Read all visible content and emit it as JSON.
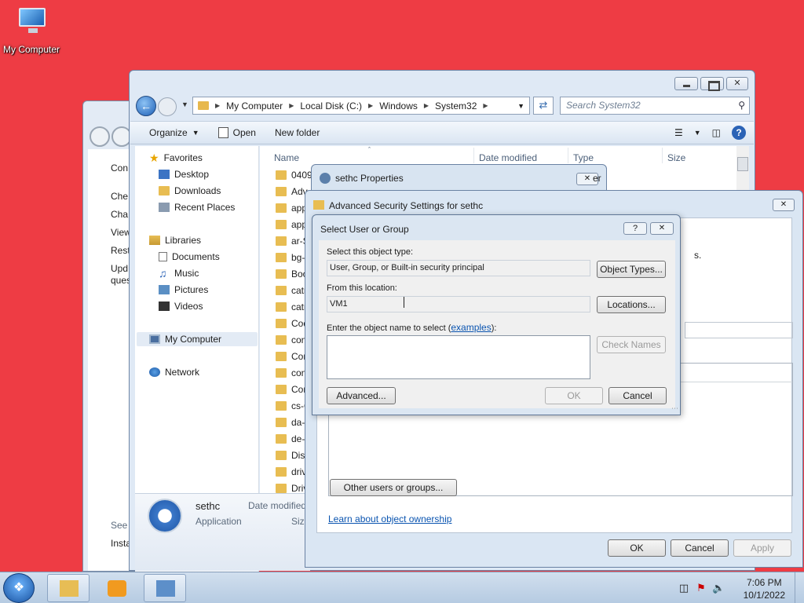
{
  "desktop": {
    "my_computer_label": "My Computer"
  },
  "back_window": {
    "links": [
      "Con",
      "Che",
      "Cha",
      "View",
      "Rest",
      "Upd",
      "ques",
      "See",
      "Installed Updates"
    ]
  },
  "explorer": {
    "breadcrumb": [
      "My Computer",
      "Local Disk (C:)",
      "Windows",
      "System32"
    ],
    "search_placeholder": "Search System32",
    "commands": {
      "organize": "Organize",
      "open": "Open",
      "new_folder": "New folder"
    },
    "nav": {
      "favorites": "Favorites",
      "desktop": "Desktop",
      "downloads": "Downloads",
      "recent": "Recent Places",
      "libraries": "Libraries",
      "documents": "Documents",
      "music": "Music",
      "pictures": "Pictures",
      "videos": "Videos",
      "my_computer": "My Computer",
      "network": "Network"
    },
    "columns": {
      "name": "Name",
      "date": "Date modified",
      "type": "Type",
      "size": "Size"
    },
    "files": [
      "0409",
      "Adv",
      "app",
      "app",
      "ar-S",
      "bg-",
      "Boo",
      "catr",
      "catr",
      "Cod",
      "con",
      "Con",
      "con",
      "Con",
      "cs-C",
      "da-",
      "de-",
      "Disn",
      "driv",
      "Driv"
    ],
    "details": {
      "name": "sethc",
      "type": "Application",
      "modified_label": "Date modified",
      "size_label": "Size"
    }
  },
  "props_window": {
    "title": "sethc Properties",
    "partial_text": "er"
  },
  "adv_window": {
    "title": "Advanced Security Settings for sethc",
    "partial_text": "s.",
    "other_users_button": "Other users or groups...",
    "learn_link": "Learn about object ownership",
    "ok": "OK",
    "cancel": "Cancel",
    "apply": "Apply"
  },
  "select_dialog": {
    "title": "Select User or Group",
    "help": "?",
    "object_type_label": "Select this object type:",
    "object_type_value": "User, Group, or Built-in security principal",
    "object_types_button": "Object Types...",
    "location_label": "From this location:",
    "location_value": "VM1",
    "locations_button": "Locations...",
    "enter_label_pre": "Enter the object name to select (",
    "examples_link": "examples",
    "enter_label_post": "):",
    "check_names_button": "Check Names",
    "advanced_button": "Advanced...",
    "ok": "OK",
    "cancel": "Cancel"
  },
  "taskbar": {
    "time": "7:06 PM",
    "date": "10/1/2022"
  },
  "colors": {
    "desktop": "#ee3c44",
    "accent": "#2b63b6"
  }
}
